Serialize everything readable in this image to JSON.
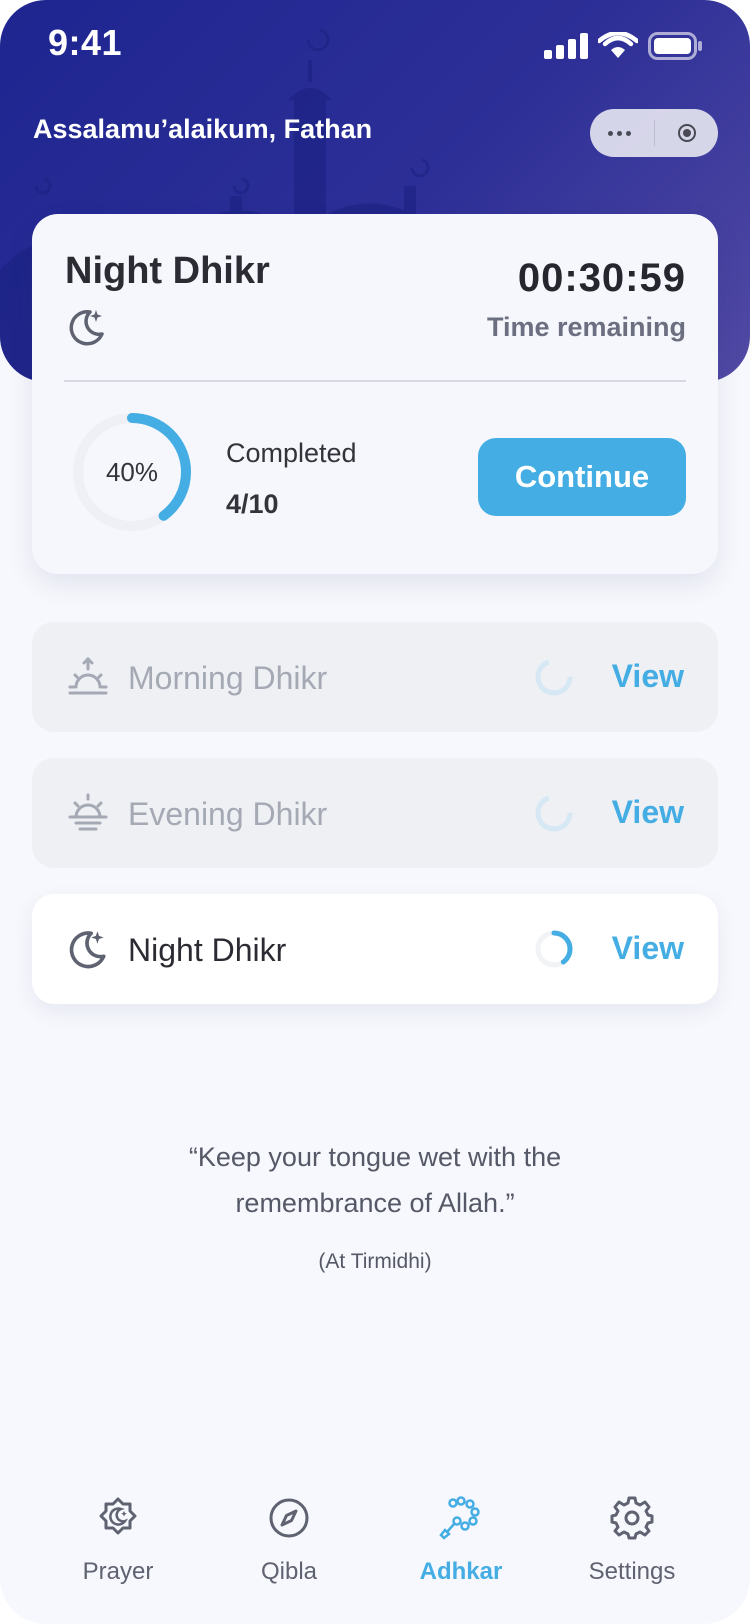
{
  "status_bar": {
    "time": "9:41"
  },
  "header": {
    "greeting": "Assalamu’alaikum, Fathan",
    "background_colors": [
      "#1e2590",
      "#524aa4"
    ]
  },
  "current_dhikr": {
    "title": "Night Dhikr",
    "icon": "moon-stars-icon",
    "timer": "00:30:59",
    "timer_label": "Time remaining",
    "progress_percent_label": "40%",
    "progress_fraction": 0.4,
    "completed_label": "Completed",
    "completed_count": "4/10",
    "continue_label": "Continue"
  },
  "dhikr_list": [
    {
      "label": "Morning Dhikr",
      "icon": "sunrise-icon",
      "view_label": "View",
      "progress_fraction": 0.0,
      "active": false
    },
    {
      "label": "Evening Dhikr",
      "icon": "sunset-icon",
      "view_label": "View",
      "progress_fraction": 0.0,
      "active": false
    },
    {
      "label": "Night Dhikr",
      "icon": "moon-stars-icon",
      "view_label": "View",
      "progress_fraction": 0.4,
      "active": true
    }
  ],
  "quote": {
    "line1": "“Keep your tongue wet with the",
    "line2": "remembrance of Allah.”",
    "source": "(At Tirmidhi)"
  },
  "bottom_nav": {
    "items": [
      {
        "label": "Prayer",
        "icon": "mosque-badge-icon",
        "selected": false
      },
      {
        "label": "Qibla",
        "icon": "compass-icon",
        "selected": false
      },
      {
        "label": "Adhkar",
        "icon": "prayer-beads-icon",
        "selected": true
      },
      {
        "label": "Settings",
        "icon": "gear-icon",
        "selected": false
      }
    ]
  },
  "colors": {
    "accent": "#44ade3",
    "page_background": "#f7f8fd",
    "text_primary": "#2b2b33",
    "text_muted": "#a5a9b4"
  }
}
